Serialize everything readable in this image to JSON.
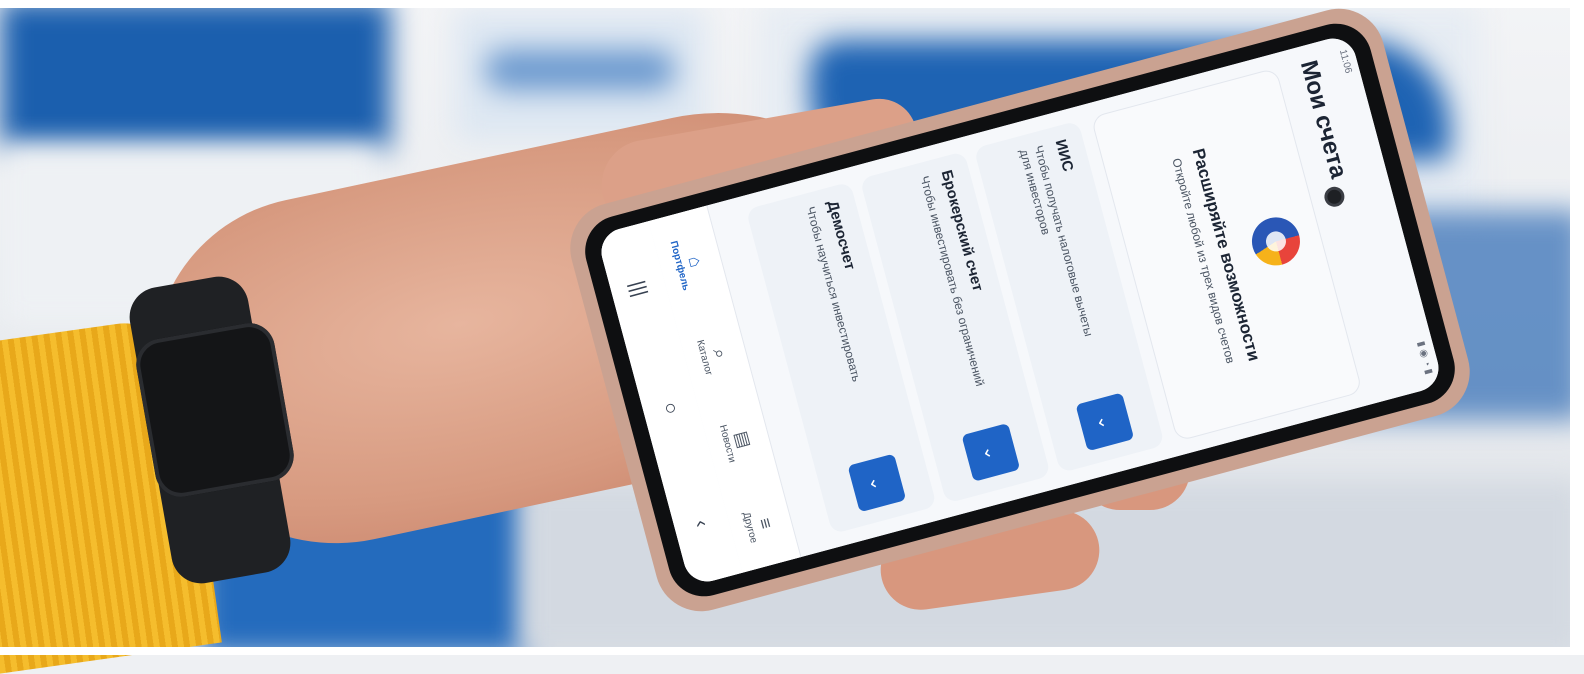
{
  "app": {
    "status_time": "11:06",
    "title": "Мои счета",
    "promo": {
      "title": "Расширяйте возможности",
      "subtitle": "Откройте любой из трех видов счетов"
    },
    "accounts": [
      {
        "title": "ИИС",
        "description": "Чтобы получать налоговые вычеты для инвесторов",
        "action_icon": "chevron-down-icon"
      },
      {
        "title": "Брокерский счет",
        "description": "Чтобы инвестировать без ограничений",
        "action_icon": "chevron-down-icon"
      },
      {
        "title": "Демосчет",
        "description": "Чтобы научиться инвестировать",
        "action_icon": "chevron-down-icon"
      }
    ],
    "tabs": [
      {
        "label": "Портфель",
        "icon": "portfolio-icon",
        "glyph": "⌂",
        "active": true
      },
      {
        "label": "Каталог",
        "icon": "search-icon",
        "glyph": "⌕",
        "active": false
      },
      {
        "label": "Новости",
        "icon": "news-icon",
        "glyph": "▤",
        "active": false
      },
      {
        "label": "Другое",
        "icon": "menu-icon",
        "glyph": "≡",
        "active": false
      }
    ],
    "system_nav": {
      "recents": "|||",
      "home": "○",
      "back": "‹"
    },
    "colors": {
      "accent": "#1f64c6",
      "case": "#caa291",
      "sleeve": "#f2b52a"
    }
  }
}
